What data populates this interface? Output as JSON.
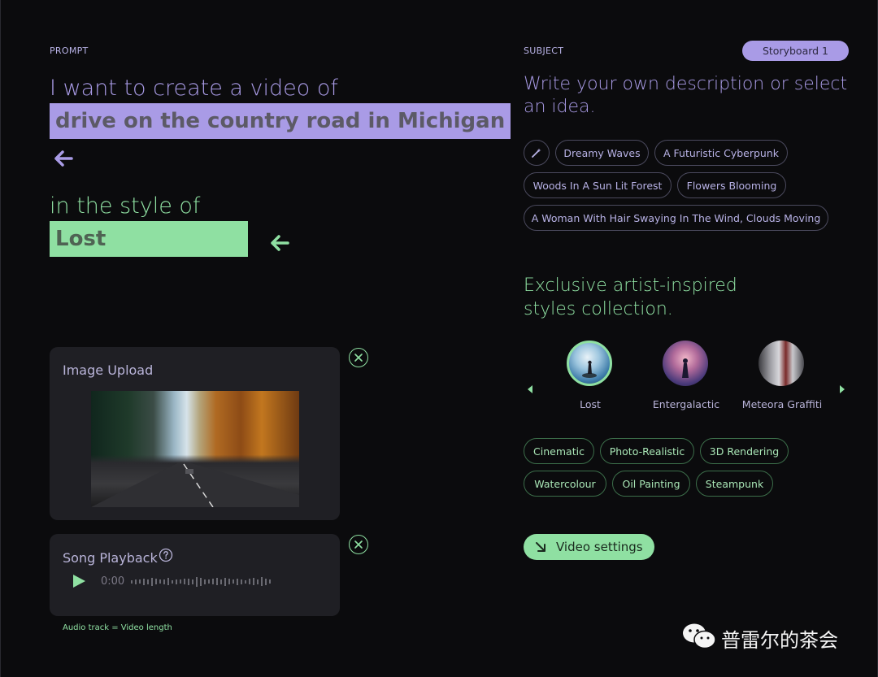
{
  "prompt": {
    "section_label": "PROMPT",
    "lead_text": "I want to create a video of",
    "subject_value": "drive on the country road in Michigan",
    "style_lead": "in the style of",
    "style_value": "Lost"
  },
  "image_upload": {
    "title": "Image Upload",
    "image_alt": "Country road through autumn forest"
  },
  "song": {
    "title": "Song Playback",
    "time": "0:00",
    "footnote": "Audio track = Video length"
  },
  "subject": {
    "section_label": "SUBJECT",
    "storyboard_label": "Storyboard 1",
    "heading": "Write your own description or select an idea.",
    "ideas": [
      "Dreamy Waves",
      "A Futuristic Cyberpunk",
      "Woods In A Sun Lit Forest",
      "Flowers Blooming",
      "A Woman With Hair Swaying In The Wind, Clouds Moving"
    ]
  },
  "styles": {
    "heading_line1": "Exclusive artist-inspired",
    "heading_line2": "styles collection.",
    "artists": [
      "Lost",
      "Entergalactic",
      "Meteora Graffiti"
    ],
    "tags": [
      "Cinematic",
      "Photo-Realistic",
      "3D Rendering",
      "Watercolour",
      "Oil Painting",
      "Steampunk"
    ]
  },
  "video_settings_label": "Video settings",
  "watermark": "普雷尔的茶会",
  "colors": {
    "accent_lavender": "#a99be6",
    "accent_green": "#8fe0a2",
    "background": "#0b0b0d",
    "panel": "#1f1f24"
  },
  "icons": [
    "arrow-left-icon",
    "close-icon",
    "help-icon",
    "play-icon",
    "magic-wand-icon",
    "caret-left-icon",
    "caret-right-icon",
    "arrow-down-right-icon",
    "wechat-icon"
  ]
}
